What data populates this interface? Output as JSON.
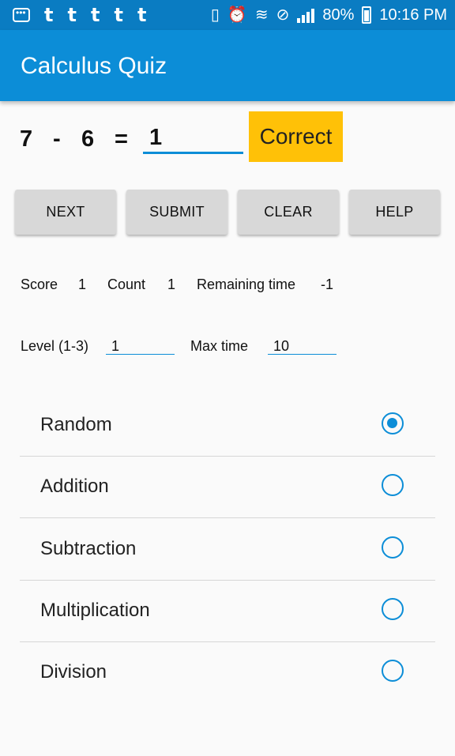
{
  "status_bar": {
    "t_icons": [
      "t",
      "t",
      "t",
      "t",
      "t"
    ],
    "battery": "80%",
    "time": "10:16 PM"
  },
  "app_bar": {
    "title": "Calculus Quiz"
  },
  "equation": {
    "operand1": "7",
    "operator": "-",
    "operand2": "6",
    "equals": "=",
    "answer": "1",
    "result": "Correct"
  },
  "buttons": {
    "next": "NEXT",
    "submit": "SUBMIT",
    "clear": "CLEAR",
    "help": "HELP"
  },
  "stats": {
    "score_label": "Score",
    "score_value": "1",
    "count_label": "Count",
    "count_value": "1",
    "remaining_label": "Remaining time",
    "remaining_value": "-1"
  },
  "settings": {
    "level_label": "Level (1-3)",
    "level_value": "1",
    "max_time_label": "Max time",
    "max_time_value": "10"
  },
  "operations": [
    {
      "label": "Random",
      "selected": true
    },
    {
      "label": "Addition",
      "selected": false
    },
    {
      "label": "Subtraction",
      "selected": false
    },
    {
      "label": "Multiplication",
      "selected": false
    },
    {
      "label": "Division",
      "selected": false
    }
  ],
  "colors": {
    "status_bar": "#0a7cc2",
    "app_bar": "#0c8dd7",
    "accent": "#0c8dd7",
    "correct_bg": "#ffc107"
  }
}
